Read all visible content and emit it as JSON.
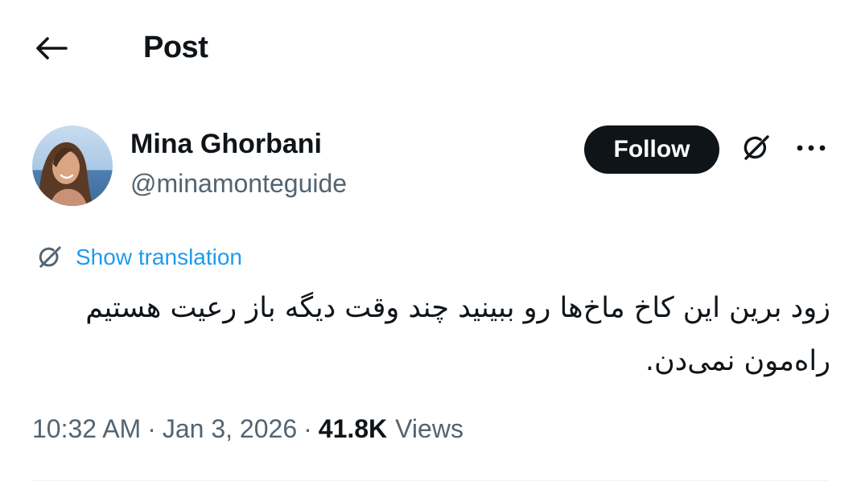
{
  "header": {
    "title": "Post",
    "back_icon": "arrow-left-icon"
  },
  "author": {
    "name": "Mina Ghorbani",
    "handle": "@minamonteguide",
    "avatar_icon": "avatar-photo"
  },
  "actions": {
    "follow_label": "Follow",
    "grok_icon": "grok-icon",
    "more_icon": "more-options-icon"
  },
  "translation": {
    "label": "Show translation",
    "icon": "grok-icon"
  },
  "post": {
    "text": "زود برین این کاخ ماخ‌ها رو ببینید چند وقت دیگه باز رعیت هستیم راه‌مون نمی‌دن."
  },
  "meta": {
    "time": "10:32 AM",
    "date": "Jan 3, 2026",
    "views_count": "41.8K",
    "views_label": "Views"
  },
  "colors": {
    "text": "#0f1419",
    "secondary": "#536471",
    "link": "#1d9bf0",
    "follow_bg": "#0f1419",
    "divider": "#eff3f4"
  }
}
